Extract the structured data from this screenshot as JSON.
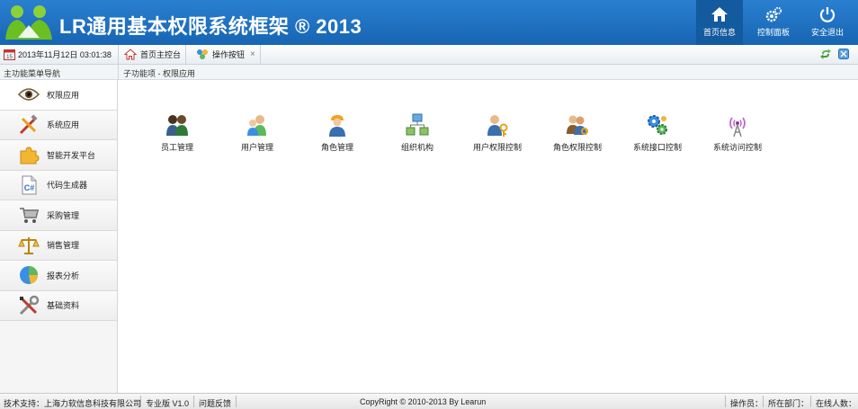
{
  "header": {
    "title": "LR通用基本权限系统框架 ® 2013",
    "buttons": [
      {
        "label": "首页信息",
        "icon": "home-icon"
      },
      {
        "label": "控制面板",
        "icon": "gears-icon"
      },
      {
        "label": "安全退出",
        "icon": "power-icon"
      }
    ]
  },
  "tabbar": {
    "date": "2013年11月12日 03:01:38",
    "tabs": [
      {
        "label": "首页主控台",
        "icon": "home-icon"
      },
      {
        "label": "操作按钮",
        "icon": "palette-icon",
        "close": "×"
      }
    ]
  },
  "subbar": {
    "nav_title": "主功能菜单导航",
    "breadcrumb": "子功能项 - 权限应用"
  },
  "sidebar": {
    "items": [
      {
        "label": "权限应用",
        "icon": "eye-icon"
      },
      {
        "label": "系统应用",
        "icon": "tools-icon"
      },
      {
        "label": "智能开发平台",
        "icon": "puzzle-icon"
      },
      {
        "label": "代码生成器",
        "icon": "csharp-file-icon"
      },
      {
        "label": "采购管理",
        "icon": "cart-icon"
      },
      {
        "label": "销售管理",
        "icon": "scale-icon"
      },
      {
        "label": "报表分析",
        "icon": "pie-chart-icon"
      },
      {
        "label": "基础资料",
        "icon": "wrench-screwdriver-icon"
      }
    ]
  },
  "main": {
    "apps": [
      {
        "label": "员工管理",
        "icon": "employees-icon"
      },
      {
        "label": "用户管理",
        "icon": "users-icon"
      },
      {
        "label": "角色管理",
        "icon": "worker-icon"
      },
      {
        "label": "组织机构",
        "icon": "organization-icon"
      },
      {
        "label": "用户权限控制",
        "icon": "user-key-icon"
      },
      {
        "label": "角色权限控制",
        "icon": "role-key-icon"
      },
      {
        "label": "系统接口控制",
        "icon": "interface-gears-icon"
      },
      {
        "label": "系统访问控制",
        "icon": "antenna-icon"
      }
    ]
  },
  "footer": {
    "support": "技术支持：上海力软信息科技有限公司",
    "edition": "专业版 V1.0",
    "feedback": "问题反馈",
    "copyright": "CopyRight © 2010-2013 By Learun",
    "operator": "操作员：",
    "department": "所在部门：",
    "online": "在线人数："
  },
  "colors": {
    "header_blue": "#1d6fc0",
    "header_active": "#135a9e"
  }
}
